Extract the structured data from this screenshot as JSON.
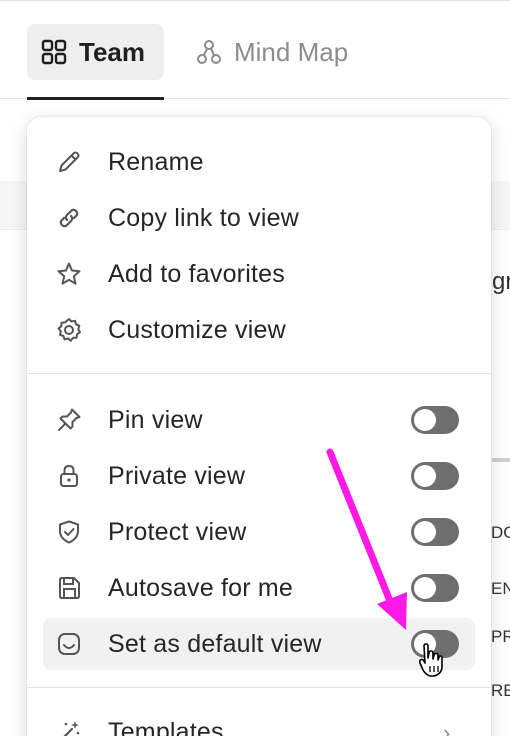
{
  "tabs": [
    {
      "label": "Team",
      "icon": "grid-icon",
      "active": true
    },
    {
      "label": "Mind Map",
      "icon": "mind-map-icon",
      "active": false
    }
  ],
  "background": {
    "fragments": [
      "gr",
      "DO",
      "EN",
      "PR",
      "RE"
    ]
  },
  "menu": {
    "section1": [
      {
        "label": "Rename",
        "icon": "pencil-icon"
      },
      {
        "label": "Copy link to view",
        "icon": "link-icon"
      },
      {
        "label": "Add to favorites",
        "icon": "star-icon"
      },
      {
        "label": "Customize view",
        "icon": "gear-icon"
      }
    ],
    "section2": [
      {
        "label": "Pin view",
        "icon": "pin-icon",
        "toggle": false
      },
      {
        "label": "Private view",
        "icon": "lock-icon",
        "toggle": false
      },
      {
        "label": "Protect view",
        "icon": "shield-icon",
        "toggle": false
      },
      {
        "label": "Autosave for me",
        "icon": "save-icon",
        "toggle": false
      },
      {
        "label": "Set as default view",
        "icon": "default-view-icon",
        "toggle": false,
        "hovered": true
      }
    ],
    "section3": [
      {
        "label": "Templates",
        "icon": "magic-wand-icon"
      }
    ]
  },
  "colors": {
    "annotation_arrow": "#ff18e6",
    "toggle_off": "#6f6f6f",
    "hover_background": "#f1f1f1"
  }
}
